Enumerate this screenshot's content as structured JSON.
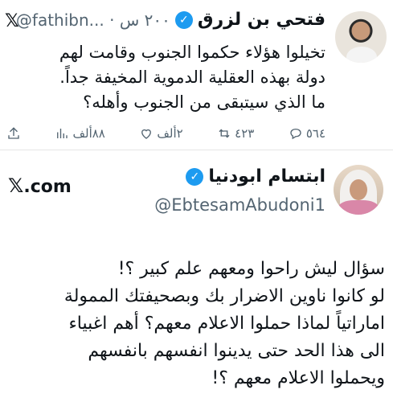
{
  "tweet": {
    "display_name": "فتحي بن لزرق",
    "handle": "@fathibn...",
    "time": "٢٠٠ س",
    "x_logo": "𝕏",
    "body_lines": [
      "تخيلوا هؤلاء حكموا الجنوب وقامت لهم",
      "دولة بهذه العقلية الدموية المخيفة جداً.",
      "ما الذي سيتبقى من الجنوب وأهله؟"
    ],
    "stats": {
      "replies": "٥٦٤",
      "reposts": "٤٢٣",
      "likes": "٢ألف",
      "views": "٨٨ألف"
    }
  },
  "profile": {
    "display_name": "ابتسام ابودنيا",
    "handle": "@EbtesamAbudoni1",
    "site_prefix": "𝕏",
    "site_suffix": ".com"
  },
  "quote": {
    "lines": [
      "سؤال ليش راحوا ومعهم علم كبير ؟!",
      "لو كانوا ناوين الاضرار بك وبصحيفتك الممولة",
      "اماراتياً لماذا حملوا الاعلام معهم؟ أهم اغبياء",
      "الى هذا الحد حتى يدينوا انفسهم بانفسهم",
      "ويحملوا الاعلام معهم ؟!"
    ]
  },
  "colors": {
    "verified": "#1d9bf0",
    "muted": "#536471",
    "text": "#0f1419"
  }
}
